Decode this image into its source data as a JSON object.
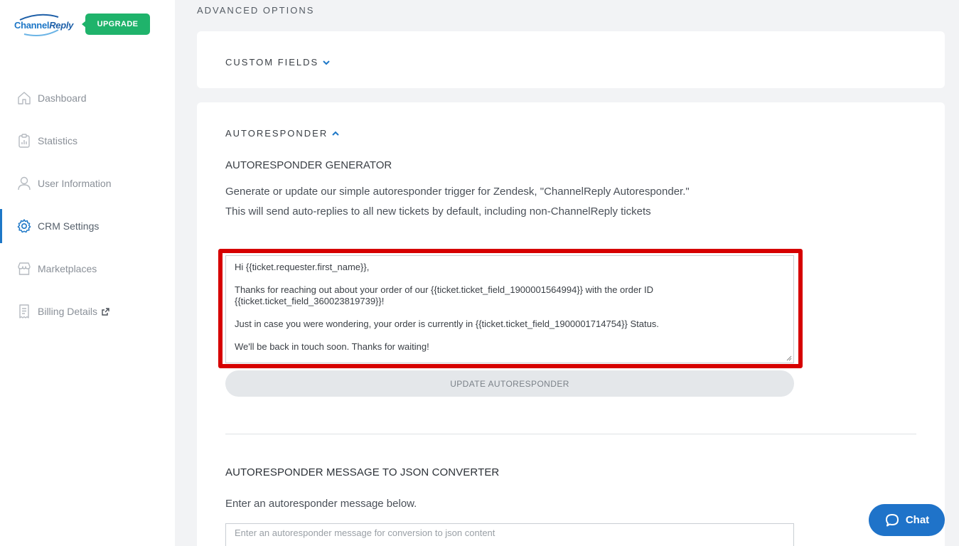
{
  "brand": {
    "logo_channel": "Channel",
    "logo_reply": "Reply",
    "upgrade_label": "UPGRADE"
  },
  "sidebar": {
    "items": [
      {
        "label": "Dashboard",
        "icon": "home-icon"
      },
      {
        "label": "Statistics",
        "icon": "clipboard-icon"
      },
      {
        "label": "User Information",
        "icon": "user-icon"
      },
      {
        "label": "CRM Settings",
        "icon": "gear-icon",
        "active": true
      },
      {
        "label": "Marketplaces",
        "icon": "store-icon"
      },
      {
        "label": "Billing Details",
        "icon": "receipt-icon",
        "external_link_icon": "external-link-icon"
      }
    ]
  },
  "main": {
    "section_title": "ADVANCED OPTIONS",
    "custom_fields_heading": "CUSTOM FIELDS",
    "autoresponder_heading": "AUTORESPONDER",
    "generator": {
      "title": "AUTORESPONDER GENERATOR",
      "description": "Generate or update our simple autoresponder trigger for Zendesk, \"ChannelReply Autoresponder.\" This will send auto-replies to all new tickets by default, including non-ChannelReply tickets",
      "message_lines": [
        "Hi {{ticket.requester.first_name}},",
        "Thanks for reaching out about your order of our {{ticket.ticket_field_1900001564994}} with the order ID {{ticket.ticket_field_360023819739}}!",
        "Just in case you were wondering, your order is currently in {{ticket.ticket_field_1900001714754}} Status.",
        "We'll be back in touch soon. Thanks for waiting!"
      ],
      "update_button": "UPDATE AUTORESPONDER"
    },
    "converter": {
      "title": "AUTORESPONDER MESSAGE TO JSON CONVERTER",
      "description": "Enter an autoresponder message below.",
      "input_placeholder": "Enter an autoresponder message for conversion to json content"
    }
  },
  "chat": {
    "label": "Chat"
  },
  "colors": {
    "accent_blue": "#1d77c7",
    "upgrade_green": "#1fb36b",
    "highlight_red": "#d60000",
    "chat_blue": "#1f73c9"
  }
}
